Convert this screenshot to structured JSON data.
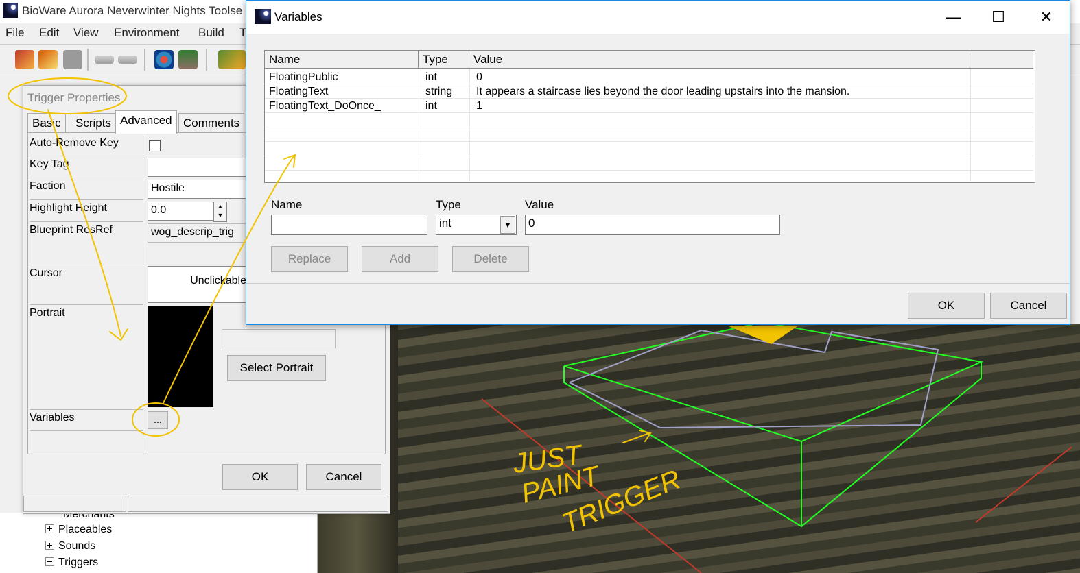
{
  "main_window": {
    "title": "BioWare Aurora Neverwinter Nights Toolse",
    "menu": [
      "File",
      "Edit",
      "View",
      "Environment",
      "Build",
      "T"
    ],
    "toolbar_icons": [
      "paint-icon",
      "paint-trigger-icon",
      "stop-icon",
      "undo-icon",
      "redo-icon",
      "zoom-icon",
      "terrain-icon",
      "rotate-icon"
    ]
  },
  "tree": {
    "items": [
      {
        "label": "Merchants",
        "expander": "plus"
      },
      {
        "label": "Placeables",
        "expander": "plus"
      },
      {
        "label": "Sounds",
        "expander": "plus"
      },
      {
        "label": "Triggers",
        "expander": "minus"
      }
    ]
  },
  "trigger_dialog": {
    "title": "Trigger Properties",
    "tabs": [
      "Basic",
      "Scripts",
      "Advanced",
      "Comments"
    ],
    "active_tab": "Advanced",
    "properties": {
      "auto_remove_key": {
        "label": "Auto-Remove Key",
        "checked": false
      },
      "key_tag": {
        "label": "Key Tag",
        "value": ""
      },
      "faction": {
        "label": "Faction",
        "value": "Hostile"
      },
      "highlight_height": {
        "label": "Highlight Height",
        "value": "0.0"
      },
      "blueprint_resref": {
        "label": "Blueprint ResRef",
        "value": "wog_descrip_trig"
      },
      "cursor": {
        "label": "Cursor",
        "value": "Unclickable"
      },
      "portrait": {
        "label": "Portrait",
        "value": ""
      },
      "variables": {
        "label": "Variables",
        "button": "..."
      }
    },
    "select_portrait_label": "Select Portrait",
    "ok_label": "OK",
    "cancel_label": "Cancel"
  },
  "variables_dialog": {
    "title": "Variables",
    "columns": [
      "Name",
      "Type",
      "Value"
    ],
    "rows": [
      {
        "name": "FloatingPublic",
        "type": "int",
        "value": "0"
      },
      {
        "name": "FloatingText",
        "type": "string",
        "value": "It appears a staircase lies beyond the door leading upstairs into the mansion."
      },
      {
        "name": "FloatingText_DoOnce_",
        "type": "int",
        "value": "1"
      }
    ],
    "editor": {
      "name_label": "Name",
      "name_value": "",
      "type_label": "Type",
      "type_value": "int",
      "value_label": "Value",
      "value_value": "0"
    },
    "replace_label": "Replace",
    "add_label": "Add",
    "delete_label": "Delete",
    "ok_label": "OK",
    "cancel_label": "Cancel",
    "window_controls": {
      "minimize": "—",
      "maximize": "☐",
      "close": "✕"
    }
  },
  "annotation": {
    "text_lines": [
      "JUST",
      "PAINT",
      "TRIGGER"
    ],
    "color": "#f2c300"
  },
  "colors": {
    "trigger_outline": "#22ff22",
    "annotation": "#f2c300",
    "selection_border": "#1e88e5"
  }
}
